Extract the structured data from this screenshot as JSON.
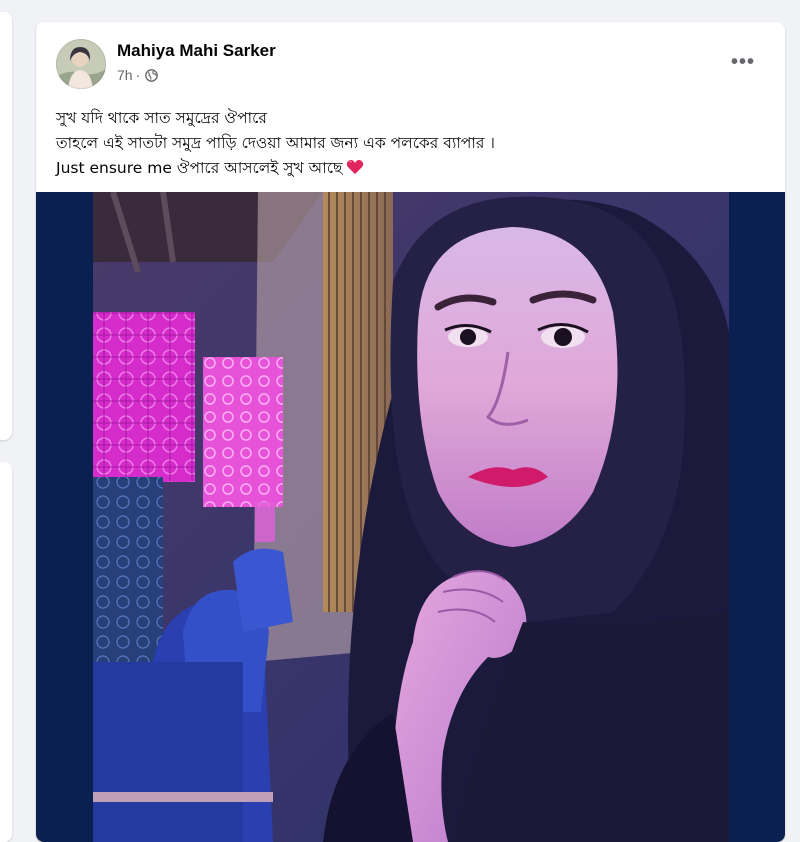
{
  "post": {
    "author": "Mahiya Mahi Sarker",
    "time": "7h",
    "separator": "·",
    "privacy_icon": "globe-icon",
    "menu_icon": "more-icon",
    "menu_label": "•••",
    "text_lines": [
      "সুখ যদি থাকে সাত সমুদ্রের ঔপারে",
      "তাহলে এই সাতটা সমুদ্র পাড়ি দেওয়া আমার জন্য এক পলকের ব্যাপার ।",
      "Just ensure me ঔপারে আসলেই সুখ আছে"
    ],
    "emoji_icon": "red-heart-icon",
    "image_icon": "post-photo",
    "colors": {
      "media_background": "#0a2050",
      "heart": "#e0245e",
      "meta_text": "#65676b"
    }
  }
}
